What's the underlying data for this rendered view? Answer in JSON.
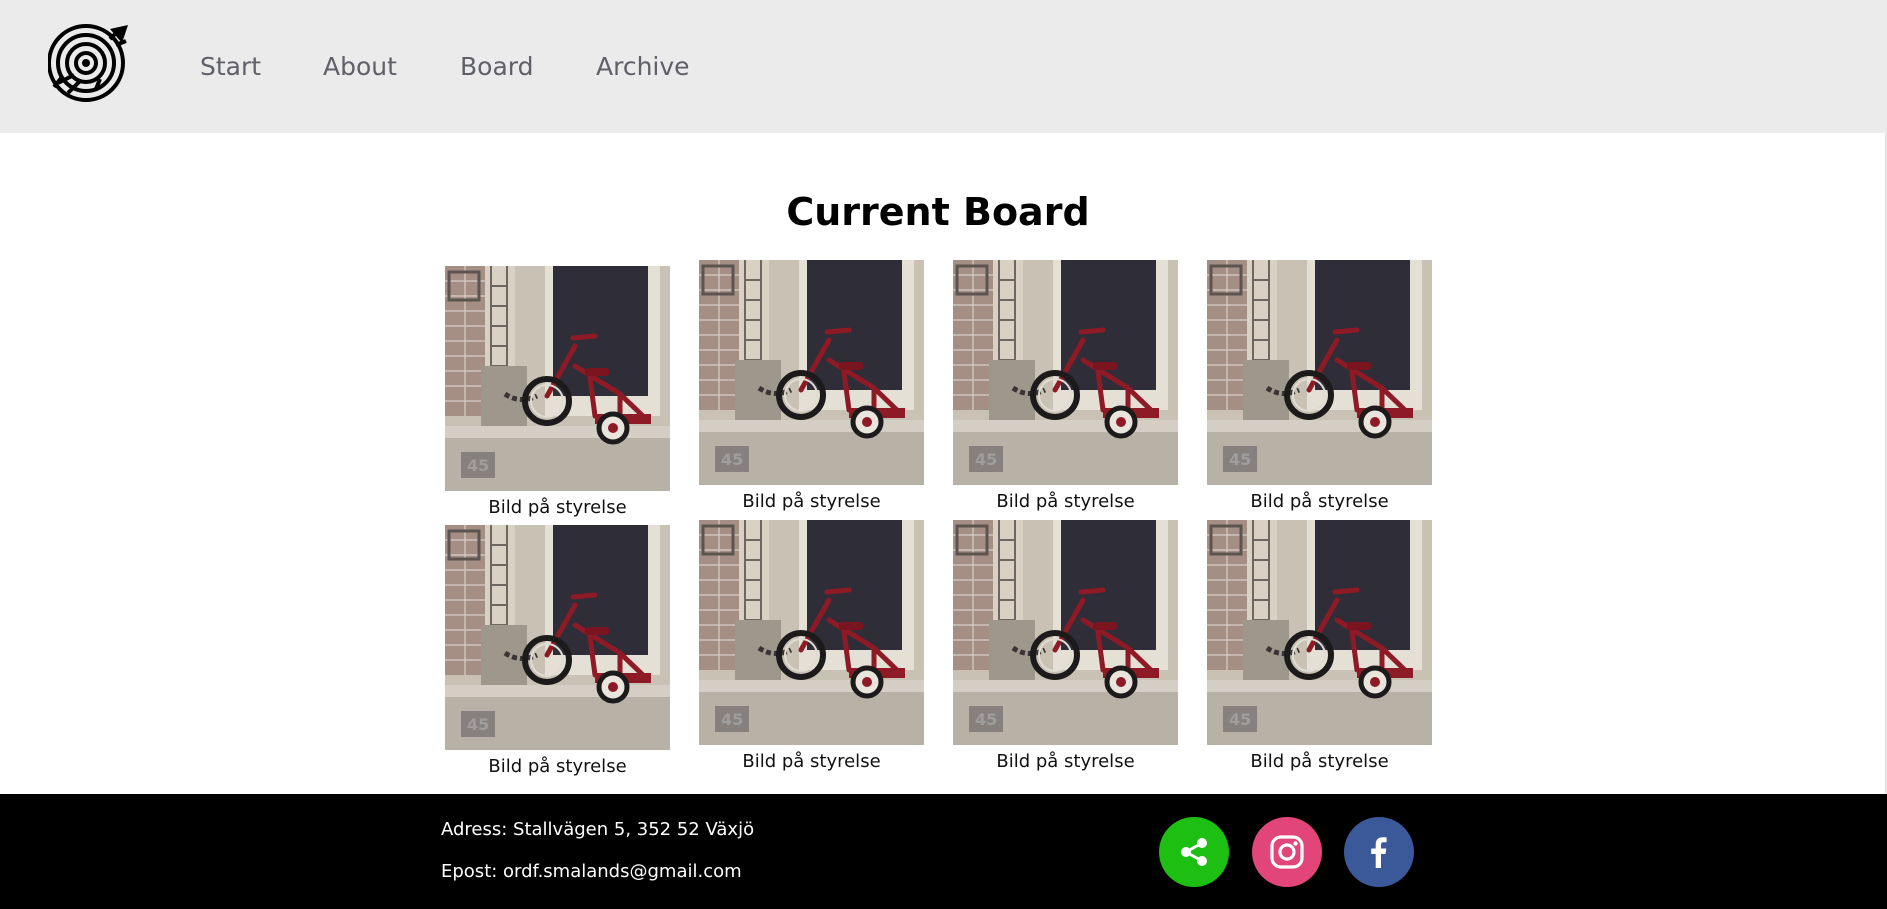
{
  "nav": {
    "items": [
      {
        "label": "Start"
      },
      {
        "label": "About"
      },
      {
        "label": "Board"
      },
      {
        "label": "Archive"
      }
    ]
  },
  "main": {
    "title": "Current Board",
    "members": [
      {
        "caption": "Bild på styrelse",
        "image": "tricycle-photo"
      },
      {
        "caption": "Bild på styrelse",
        "image": "tricycle-photo"
      },
      {
        "caption": "Bild på styrelse",
        "image": "tricycle-photo"
      },
      {
        "caption": "Bild på styrelse",
        "image": "tricycle-photo"
      },
      {
        "caption": "Bild på styrelse",
        "image": "tricycle-photo"
      },
      {
        "caption": "Bild på styrelse",
        "image": "tricycle-photo"
      },
      {
        "caption": "Bild på styrelse",
        "image": "tricycle-photo"
      },
      {
        "caption": "Bild på styrelse",
        "image": "tricycle-photo"
      }
    ]
  },
  "footer": {
    "address": "Adress: Stallvägen 5, 352 52 Växjö",
    "email": "Epost: ordf.smalands@gmail.com",
    "social": [
      {
        "icon": "share-icon",
        "color": "#1cbf12"
      },
      {
        "icon": "instagram-icon",
        "color": "#e2457a"
      },
      {
        "icon": "facebook-icon",
        "color": "#3b5998"
      }
    ]
  },
  "colors": {
    "header_bg": "#ebebeb",
    "nav_text": "#5f6068",
    "footer_bg": "#000000"
  }
}
